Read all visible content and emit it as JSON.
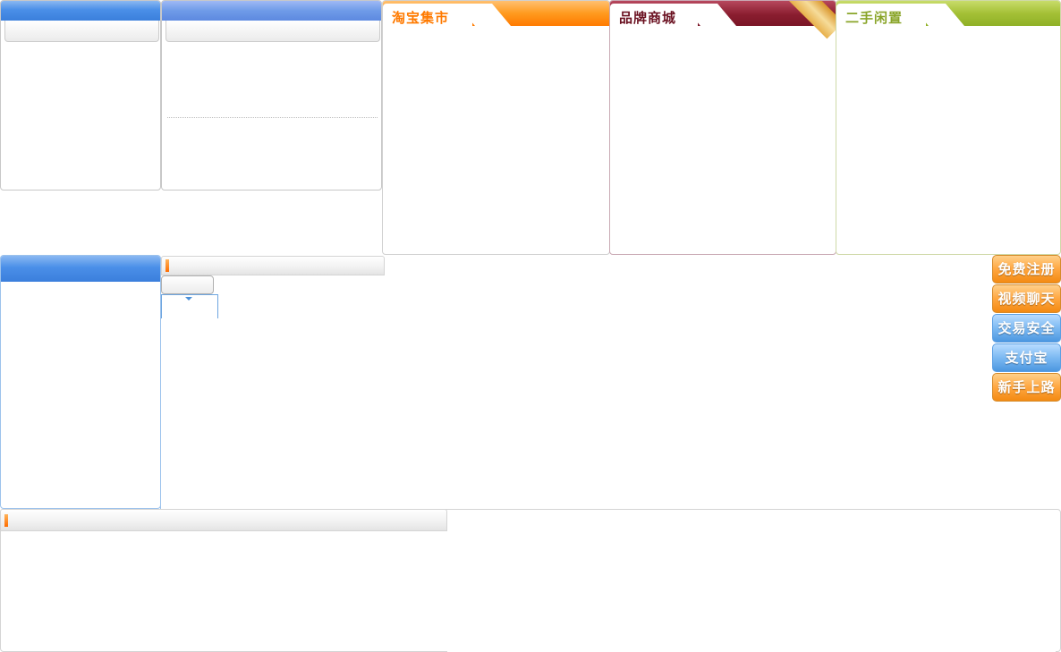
{
  "markets": [
    {
      "title": "淘宝集市",
      "title_color": "#ff7a00"
    },
    {
      "title": "品牌商城",
      "title_color": "#6a1020"
    },
    {
      "title": "二手闲置",
      "title_color": "#8aa52a"
    }
  ],
  "side_buttons": [
    {
      "label": "免费注册"
    },
    {
      "label": "视频聊天"
    },
    {
      "label": "交易安全"
    },
    {
      "label": "支付宝"
    },
    {
      "label": "新手上路"
    }
  ],
  "colors": {
    "orange": "#ff7a00",
    "maroon": "#8a1d2f",
    "green": "#a4c036",
    "blue": "#3b7fdc"
  }
}
